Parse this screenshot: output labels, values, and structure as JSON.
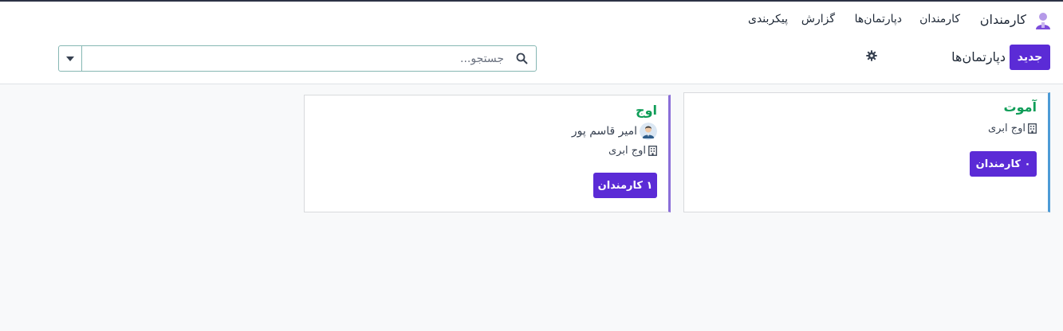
{
  "nav": {
    "app_name": "کارمندان",
    "items": [
      "کارمندان",
      "دپارتمان‌ها",
      "گزارش",
      "پیکربندی"
    ]
  },
  "control": {
    "new_label": "جدید",
    "breadcrumb": "دپارتمان‌ها",
    "search_placeholder": "جستجو..."
  },
  "cards": [
    {
      "title": "آموت",
      "company": "اوج ابری",
      "button_label": "۰ کارمندان"
    },
    {
      "title": "اوج",
      "manager": "امیر قاسم پور",
      "company": "اوج ابری",
      "button_label": "۱ کارمندان"
    }
  ],
  "colors": {
    "primary": "#5b2bd6",
    "title_green": "#0f9d58",
    "card_a_stripe": "#4d9bd6",
    "card_b_stripe": "#8b6fd8"
  },
  "icons": [
    "app-employees-icon",
    "gear-icon",
    "search-icon",
    "caret-down-icon",
    "building-icon",
    "avatar"
  ]
}
